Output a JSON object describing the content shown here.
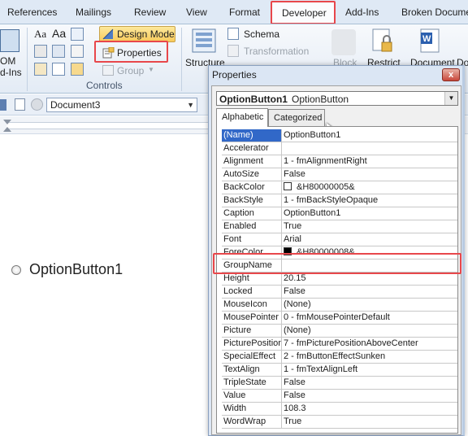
{
  "ribbon_tabs": [
    "References",
    "Mailings",
    "Review",
    "View",
    "Format",
    "Developer",
    "Add-Ins",
    "Broken Docume"
  ],
  "ribbon": {
    "addins_top": "OM",
    "addins_bottom": "d-Ins",
    "design_mode": "Design Mode",
    "properties": "Properties",
    "group": "Group",
    "controls_label": "Controls",
    "schema": "Schema",
    "transformation": "Transformation",
    "structure": "Structure",
    "block": "Block",
    "restrict": "Restrict",
    "document": "Document",
    "document2": "Do"
  },
  "toolbar": {
    "document_combo": "Document3"
  },
  "document": {
    "option_button_caption": "OptionButton1"
  },
  "properties_window": {
    "title": "Properties",
    "close_label": "x",
    "object_name": "OptionButton1",
    "object_type": "OptionButton",
    "tab_alphabetic": "Alphabetic",
    "tab_categorized": "Categorized",
    "rows": [
      {
        "name": "(Name)",
        "value": "OptionButton1"
      },
      {
        "name": "Accelerator",
        "value": ""
      },
      {
        "name": "Alignment",
        "value": "1 - fmAlignmentRight"
      },
      {
        "name": "AutoSize",
        "value": "False"
      },
      {
        "name": "BackColor",
        "value": "&H80000005&"
      },
      {
        "name": "BackStyle",
        "value": "1 - fmBackStyleOpaque"
      },
      {
        "name": "Caption",
        "value": "OptionButton1"
      },
      {
        "name": "Enabled",
        "value": "True"
      },
      {
        "name": "Font",
        "value": "Arial"
      },
      {
        "name": "ForeColor",
        "value": "&H80000008&"
      },
      {
        "name": "GroupName",
        "value": ""
      },
      {
        "name": "Height",
        "value": "20.15"
      },
      {
        "name": "Locked",
        "value": "False"
      },
      {
        "name": "MouseIcon",
        "value": "(None)"
      },
      {
        "name": "MousePointer",
        "value": "0 - fmMousePointerDefault"
      },
      {
        "name": "Picture",
        "value": "(None)"
      },
      {
        "name": "PicturePosition",
        "value": "7 - fmPicturePositionAboveCenter"
      },
      {
        "name": "SpecialEffect",
        "value": "2 - fmButtonEffectSunken"
      },
      {
        "name": "TextAlign",
        "value": "1 - fmTextAlignLeft"
      },
      {
        "name": "TripleState",
        "value": "False"
      },
      {
        "name": "Value",
        "value": "False"
      },
      {
        "name": "Width",
        "value": "108.3"
      },
      {
        "name": "WordWrap",
        "value": "True"
      }
    ]
  },
  "colors": {
    "highlight_red": "#e8474b",
    "selection_blue": "#3168c8",
    "backcolor_swatch": "#ffffff",
    "forecolor_swatch": "#000000"
  }
}
